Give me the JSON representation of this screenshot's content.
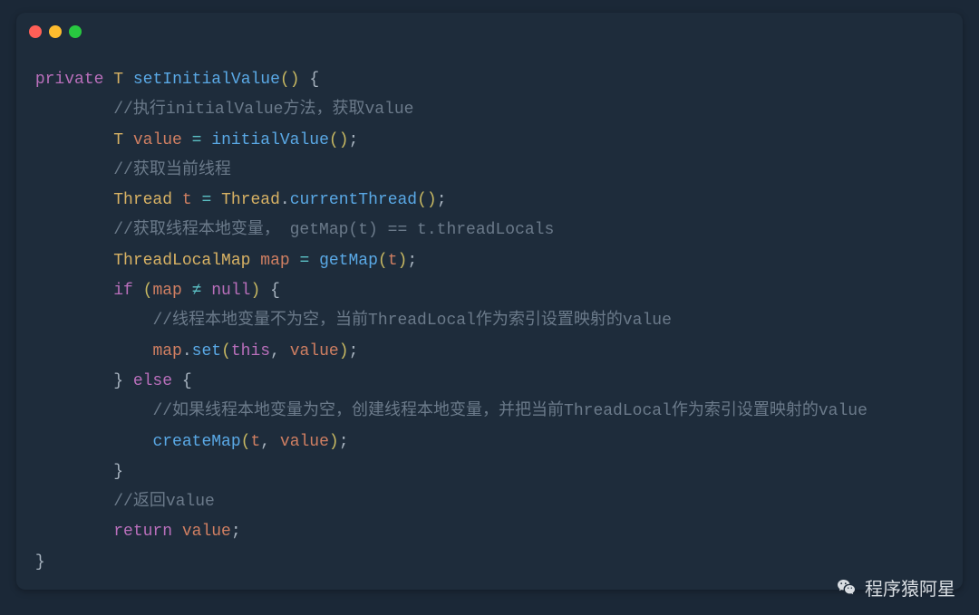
{
  "code": {
    "l1": {
      "kw": "private",
      "type": "T",
      "fn": "setInitialValue",
      "paren": "()",
      "brace": " {"
    },
    "l2": {
      "comment": "//执行initialValue方法，获取value"
    },
    "l3": {
      "type": "T",
      "var": "value",
      "op": " = ",
      "fn": "initialValue",
      "paren": "()",
      "semi": ";"
    },
    "l4": {
      "comment": "//获取当前线程"
    },
    "l5": {
      "type": "Thread",
      "var": "t",
      "op": " = ",
      "cls": "Thread",
      "dot": ".",
      "fn": "currentThread",
      "paren": "()",
      "semi": ";"
    },
    "l6": {
      "comment": "//获取线程本地变量， getMap(t) == t.threadLocals"
    },
    "l7": {
      "type": "ThreadLocalMap",
      "var": "map",
      "op": " = ",
      "fn": "getMap",
      "po": "(",
      "arg": "t",
      "pc": ")",
      "semi": ";"
    },
    "l8": {
      "kw": "if",
      "po": " (",
      "var": "map",
      "neq": " ≠ ",
      "null": "null",
      "pc": ")",
      "brace": " {"
    },
    "l9": {
      "comment": "//线程本地变量不为空，当前ThreadLocal作为索引设置映射的value"
    },
    "l10": {
      "obj": "map",
      "dot": ".",
      "fn": "set",
      "po": "(",
      "this": "this",
      "comma": ", ",
      "arg": "value",
      "pc": ")",
      "semi": ";"
    },
    "l11": {
      "brace": "}",
      "kw": " else ",
      "brace2": "{"
    },
    "l12": {
      "comment": "//如果线程本地变量为空，创建线程本地变量，并把当前ThreadLocal作为索引设置映射的value"
    },
    "l13": {
      "fn": "createMap",
      "po": "(",
      "a1": "t",
      "comma": ", ",
      "a2": "value",
      "pc": ")",
      "semi": ";"
    },
    "l14": {
      "brace": "}"
    },
    "l15": {
      "comment": "//返回value"
    },
    "l16": {
      "kw": "return",
      "sp": " ",
      "var": "value",
      "semi": ";"
    },
    "l17": {
      "brace": "}"
    }
  },
  "indent": {
    "i0": " ",
    "i1": "         ",
    "i2": "             "
  },
  "watermark": "程序猿阿星"
}
